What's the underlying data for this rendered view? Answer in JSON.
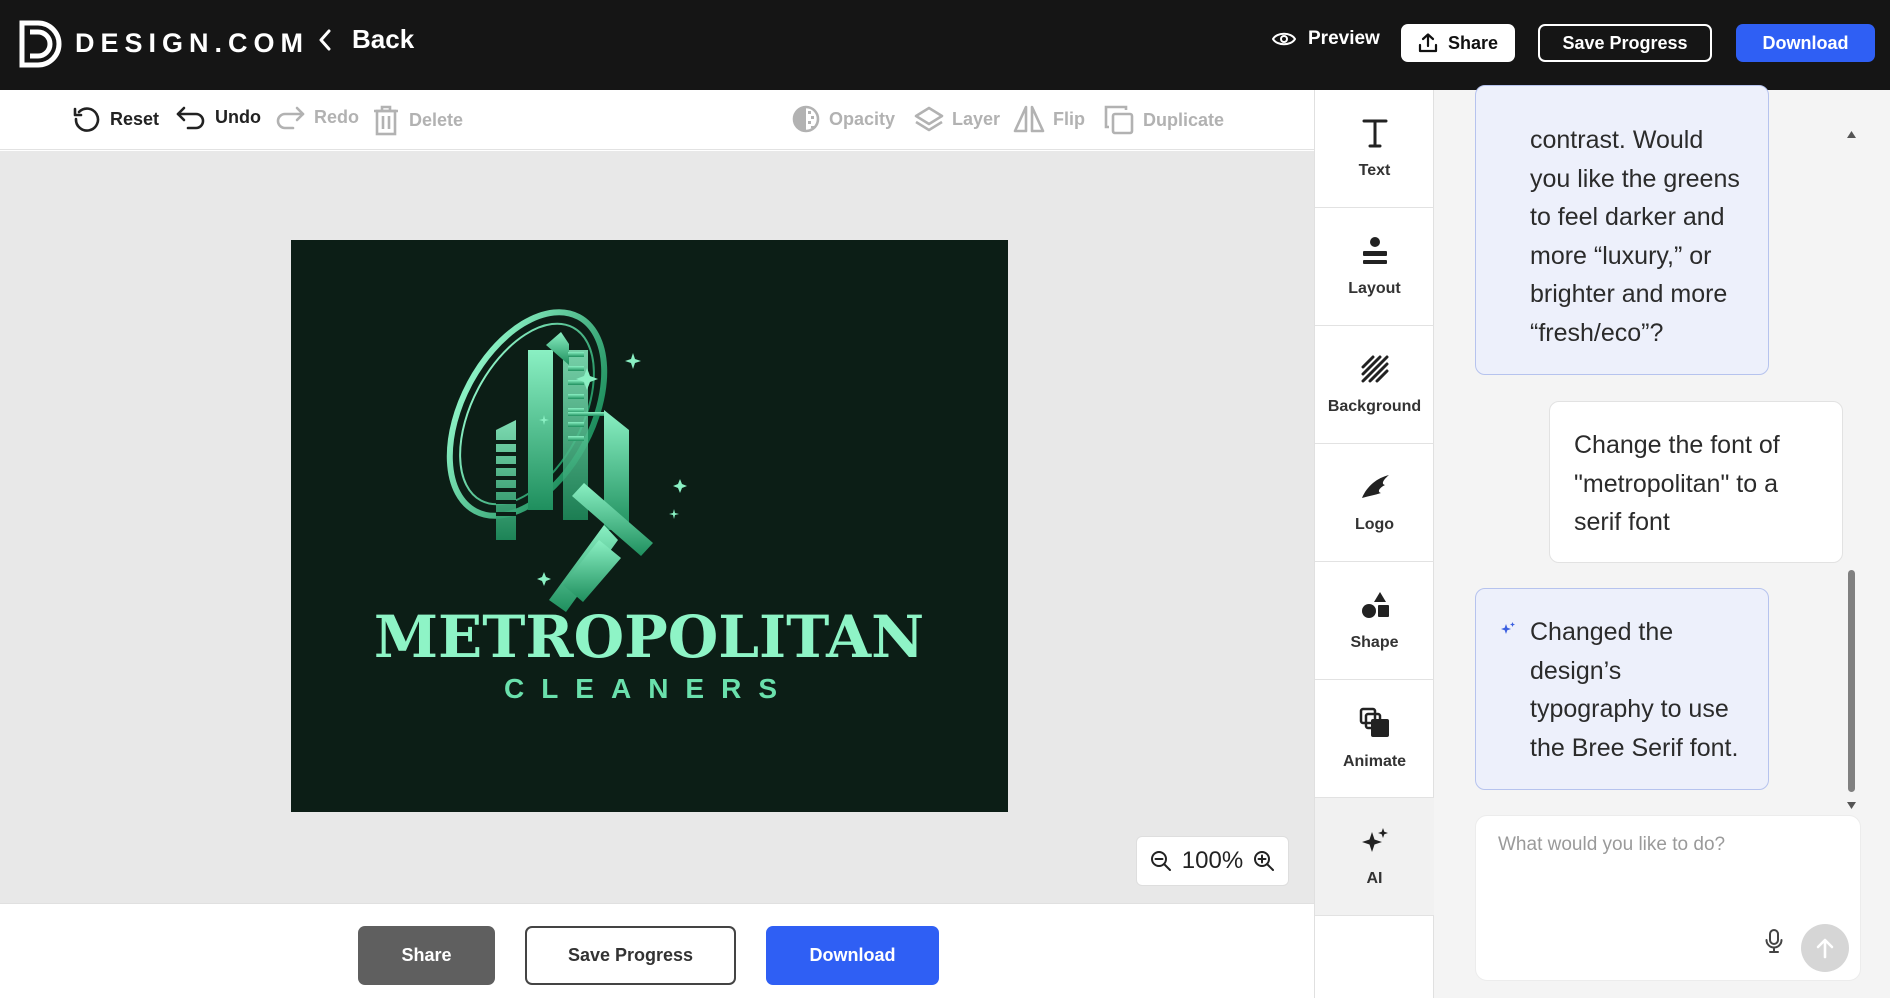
{
  "header": {
    "brand": "DESIGN.COM",
    "back_label": "Back",
    "preview_label": "Preview",
    "share_label": "Share",
    "save_label": "Save Progress",
    "download_label": "Download"
  },
  "toolbar": {
    "reset": "Reset",
    "undo": "Undo",
    "redo": "Redo",
    "delete": "Delete",
    "opacity": "Opacity",
    "layer": "Layer",
    "flip": "Flip",
    "duplicate": "Duplicate"
  },
  "canvas": {
    "logo_title": "METROPOLITAN",
    "logo_subtitle": "CLEANERS",
    "zoom_level": "100%"
  },
  "bottom": {
    "share_label": "Share",
    "save_label": "Save Progress",
    "download_label": "Download"
  },
  "sidebar": {
    "items": [
      {
        "label": "Text",
        "icon": "text-icon"
      },
      {
        "label": "Layout",
        "icon": "layout-icon"
      },
      {
        "label": "Background",
        "icon": "background-icon"
      },
      {
        "label": "Logo",
        "icon": "logo-icon"
      },
      {
        "label": "Shape",
        "icon": "shape-icon"
      },
      {
        "label": "Animate",
        "icon": "animate-icon"
      },
      {
        "label": "AI",
        "icon": "ai-sparkle-icon"
      }
    ]
  },
  "chat": {
    "messages": [
      {
        "role": "assistant",
        "lines": [
          "contrast. Would",
          "you like the greens",
          "to feel darker and",
          "more “luxury,” or",
          "brighter and more",
          "“fresh/eco”?"
        ]
      },
      {
        "role": "user",
        "lines": [
          "Change the font of",
          "\"metropolitan\" to a",
          "serif font"
        ]
      },
      {
        "role": "assistant",
        "lines": [
          "Changed the",
          "design’s",
          "typography to use",
          "the Bree Serif font."
        ]
      }
    ],
    "input_placeholder": "What would you like to do?"
  },
  "colors": {
    "accent_blue": "#2f5ff4",
    "header_bg": "#151515",
    "artboard_bg": "#0c1e16",
    "logo_green": "#5fd9a0"
  }
}
